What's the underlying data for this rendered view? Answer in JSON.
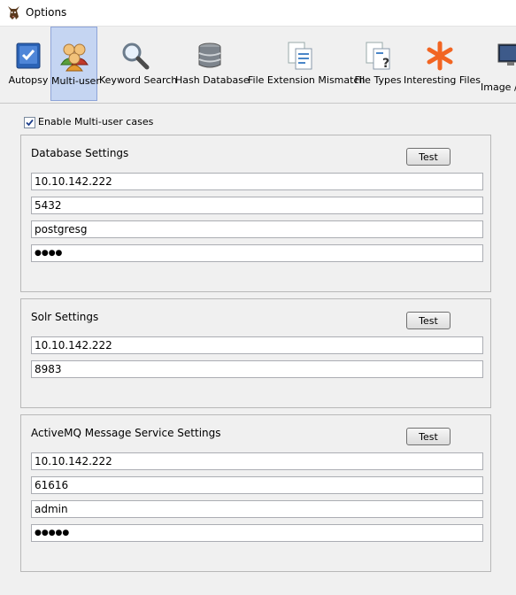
{
  "window": {
    "title": "Options"
  },
  "toolbar": {
    "items": [
      {
        "label": "Autopsy",
        "icon": "autopsy-check-icon"
      },
      {
        "label": "Multi-user",
        "icon": "users-icon",
        "selected": true
      },
      {
        "label": "Keyword Search",
        "icon": "magnifier-icon"
      },
      {
        "label": "Hash Database",
        "icon": "database-icon"
      },
      {
        "label": "File Extension Mismatch",
        "icon": "documents-icon"
      },
      {
        "label": "File Types",
        "icon": "file-question-icon"
      },
      {
        "label": "Interesting Files",
        "icon": "asterisk-icon"
      },
      {
        "label": "Image /",
        "icon": "monitor-icon"
      }
    ]
  },
  "multiuser": {
    "enable_label": "Enable Multi-user cases",
    "enabled": true
  },
  "database_settings": {
    "title": "Database Settings",
    "test_label": "Test",
    "host": "10.10.142.222",
    "port": "5432",
    "user": "postgresg",
    "password": "●●●●"
  },
  "solr_settings": {
    "title": "Solr Settings",
    "test_label": "Test",
    "host": "10.10.142.222",
    "port": "8983"
  },
  "activemq_settings": {
    "title": "ActiveMQ Message Service Settings",
    "test_label": "Test",
    "host": "10.10.142.222",
    "port": "61616",
    "user": "admin",
    "password": "●●●●●"
  },
  "colors": {
    "selected_tab_bg": "#c5d5f2",
    "window_bg": "#f0f0f0",
    "asterisk": "#f26522"
  }
}
